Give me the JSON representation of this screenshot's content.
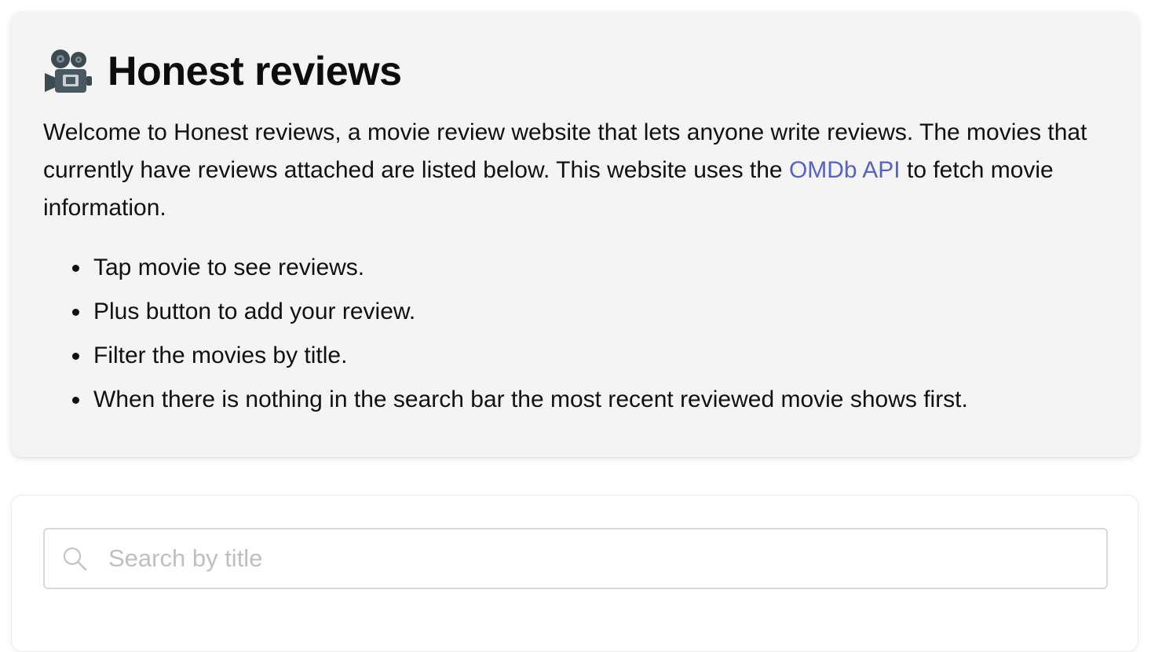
{
  "header": {
    "title_icon": "movie-camera-icon",
    "title": "Honest reviews"
  },
  "intro": {
    "text_before_link": "Welcome to Honest reviews, a movie review website that lets anyone write reviews. The movies that currently have reviews attached are listed below. This website uses the ",
    "link_text": "OMDb API",
    "text_after_link": " to fetch movie information."
  },
  "tips": [
    "Tap movie to see reviews.",
    "Plus button to add your review.",
    "Filter the movies by title.",
    "When there is nothing in the search bar the most recent reviewed movie shows first."
  ],
  "search": {
    "icon": "search-icon",
    "placeholder": "Search by title",
    "value": ""
  },
  "colors": {
    "link": "#5663c4",
    "card_background": "#f4f4f4",
    "placeholder": "#bfbfbf"
  }
}
